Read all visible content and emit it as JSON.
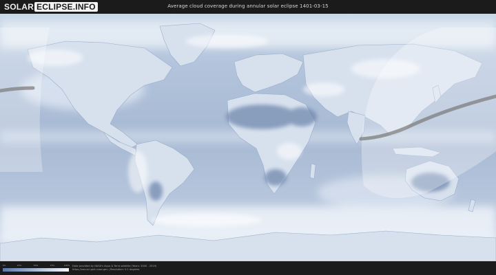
{
  "header": {
    "logo_part1": "SOLAR",
    "logo_part2": "ECLIPSE.INFO",
    "title": "Average cloud coverage during annular solar eclipse 1401-03-15"
  },
  "legend": {
    "ticks": [
      "0%",
      "25%",
      "50%",
      "75%",
      "100%"
    ],
    "colors": [
      "#5b7aa8",
      "#8ea5c7",
      "#c4d1e3",
      "#f4f6fa"
    ]
  },
  "credits": {
    "line1": "Data provided by NASA's Aqua & Terra satellite (Years: 2000 - 2019)",
    "line2": "https://neo.sci.gsfc.nasa.gov | Resolution: 0.1 degrees"
  },
  "colors": {
    "ocean": "#9fb2cd",
    "land": "#dde6f2",
    "cloud": "#ffffff",
    "path": "#7d7d7d",
    "shadow": "#ffffff"
  }
}
